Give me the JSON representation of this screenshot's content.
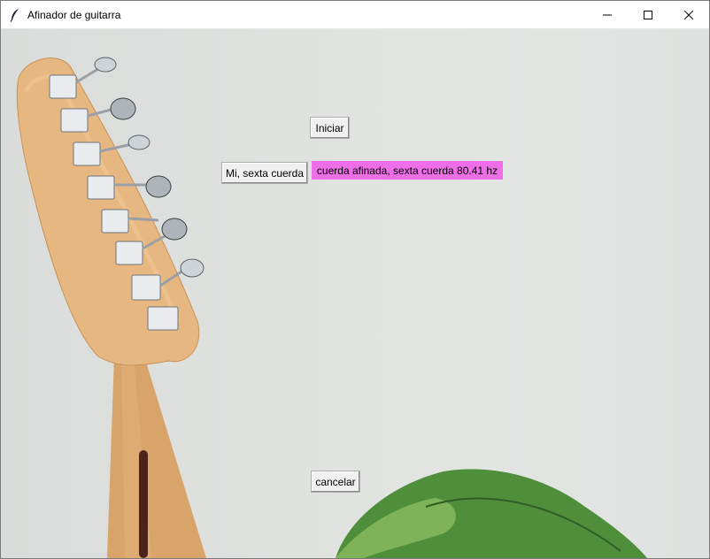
{
  "window": {
    "title": "Afinador de guitarra"
  },
  "buttons": {
    "start_label": "Iniciar",
    "string_label": "Mi, sexta cuerda",
    "cancel_label": "cancelar"
  },
  "status": {
    "text": "cuerda afinada, sexta cuerda 80.41 hz",
    "background": "#ee6ee8"
  },
  "icons": {
    "app": "feather-icon",
    "minimize": "minimize-icon",
    "maximize": "maximize-icon",
    "close": "close-icon"
  }
}
